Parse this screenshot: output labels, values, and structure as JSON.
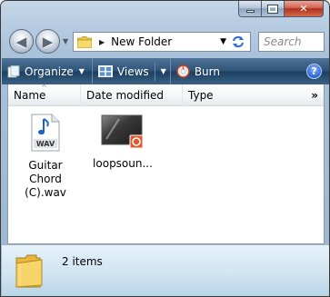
{
  "window": {
    "caption": {
      "minimize": "",
      "maximize": "",
      "close": "✕"
    }
  },
  "address_bar": {
    "separator": "▶",
    "path": "New Folder",
    "dropdown": "▼"
  },
  "search": {
    "placeholder": "Search"
  },
  "toolbar": {
    "organize_label": "Organize",
    "views_label": "Views",
    "burn_label": "Burn",
    "dropdown_arrow": "▼",
    "help_label": "?"
  },
  "columns": {
    "name": "Name",
    "date_modified": "Date modified",
    "type": "Type",
    "more": "»",
    "sort_indicator": "^"
  },
  "files": [
    {
      "label_line1": "Guitar Chord",
      "label_line2": "(C).wav",
      "icon": "wav-file-icon",
      "badge": "WAV"
    },
    {
      "label_line1": "loopsoun...",
      "icon": "video-file-icon"
    }
  ],
  "details": {
    "summary": "2 items"
  },
  "colors": {
    "accent": "#2e5478",
    "close_red": "#b2301a",
    "folder_yellow": "#f2c94c"
  }
}
